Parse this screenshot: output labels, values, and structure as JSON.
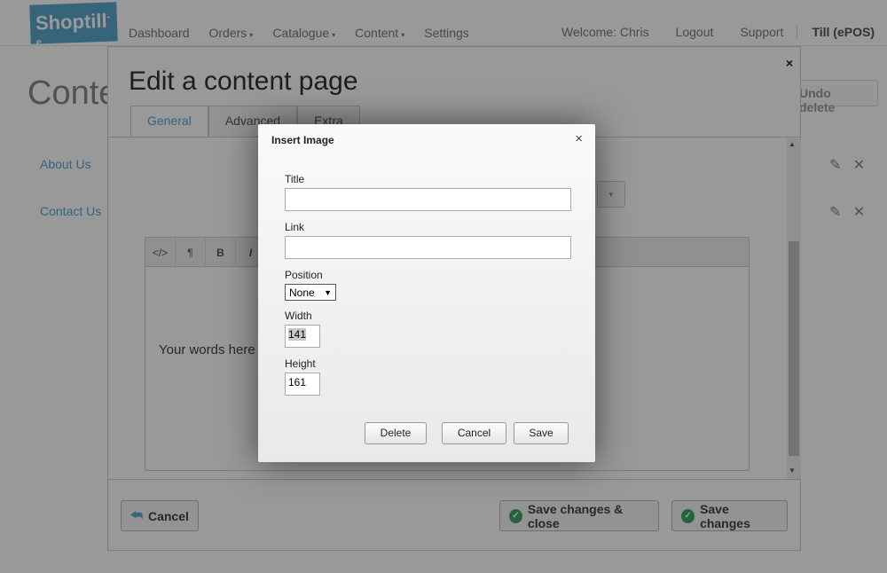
{
  "nav": {
    "logo": "Shoptill",
    "logo_suffix": "-e",
    "items": [
      "Dashboard",
      "Orders",
      "Catalogue",
      "Content",
      "Settings"
    ],
    "welcome": "Welcome: Chris",
    "logout": "Logout",
    "support": "Support",
    "till": "Till (ePOS)"
  },
  "page": {
    "title": "Conte",
    "undo": "Undo delete",
    "links": [
      "About Us",
      "Contact Us"
    ]
  },
  "edit_panel": {
    "title": "Edit a content page",
    "close": "×",
    "tabs": [
      "General",
      "Advanced",
      "Extra"
    ],
    "toolbar": [
      "</>",
      "¶",
      "B",
      "I"
    ],
    "editor_text": "Your words here",
    "cancel": "Cancel",
    "save_close": "Save changes & close",
    "save": "Save changes"
  },
  "dialog": {
    "title": "Insert Image",
    "close": "×",
    "title_label": "Title",
    "title_value": "",
    "link_label": "Link",
    "link_value": "",
    "position_label": "Position",
    "position_value": "None",
    "width_label": "Width",
    "width_value": "141",
    "height_label": "Height",
    "height_value": "161",
    "delete": "Delete",
    "cancel": "Cancel",
    "save": "Save"
  },
  "colors": {
    "brand": "#5aa7cd",
    "success": "#3fa66a"
  }
}
